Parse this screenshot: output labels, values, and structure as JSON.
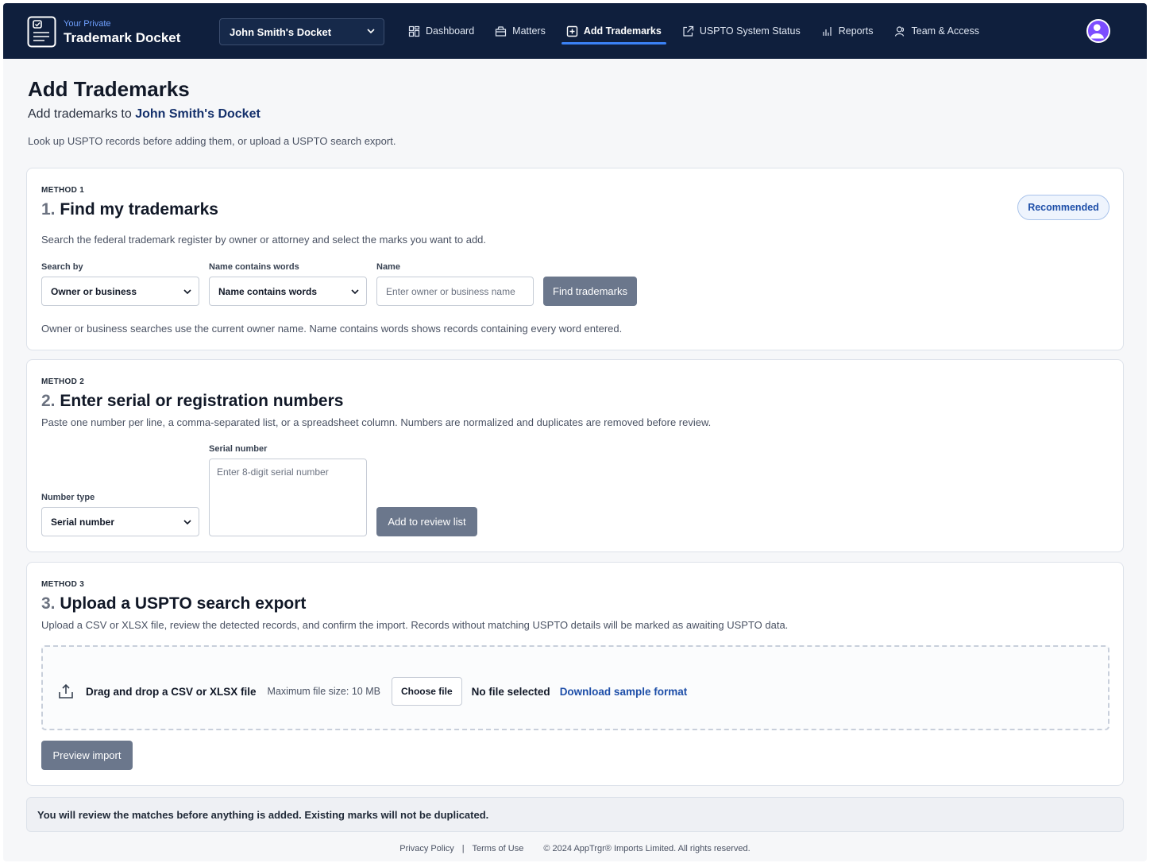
{
  "brand": {
    "sub": "Your Private",
    "title": "Trademark Docket"
  },
  "docket_selector": {
    "value": "John Smith's Docket"
  },
  "nav": {
    "dashboard": "Dashboard",
    "matters": "Matters",
    "add_trademarks": "Add Trademarks",
    "uspto_status": "USPTO System Status",
    "reports": "Reports",
    "team_access": "Team & Access"
  },
  "header": {
    "title": "Add Trademarks",
    "subtitle_prefix": "Add trademarks to",
    "subtitle_docket": "John Smith's Docket",
    "description": "Look up USPTO records before adding them, or upload a USPTO search export."
  },
  "method1": {
    "tag": "METHOD 1",
    "number": "1.",
    "title": "Find my trademarks",
    "badge": "Recommended",
    "description": "Search the federal trademark register by owner or attorney and select the marks you want to add.",
    "search_by_label": "Search by",
    "search_by_value": "Owner or business",
    "match_label": "Name contains words",
    "match_value": "Name contains words",
    "name_label": "Name",
    "name_placeholder": "Enter owner or business name",
    "button": "Find trademarks",
    "hint": "Owner or business searches use the current owner name. Name contains words shows records containing every word entered."
  },
  "method2": {
    "tag": "METHOD 2",
    "number": "2.",
    "title": "Enter serial or registration numbers",
    "description": "Paste one number per line, a comma-separated list, or a spreadsheet column. Numbers are normalized and duplicates are removed before review.",
    "type_label": "Number type",
    "type_value": "Serial number",
    "serial_label": "Serial number",
    "serial_placeholder": "Enter 8-digit serial number",
    "button": "Add to review list"
  },
  "method3": {
    "tag": "METHOD 3",
    "number": "3.",
    "title": "Upload a USPTO search export",
    "description": "Upload a CSV or XLSX file, review the detected records, and confirm the import. Records without matching USPTO details will be marked as awaiting USPTO data.",
    "drop_text": "Drag and drop a CSV or XLSX file",
    "max_size": "Maximum file size: 10 MB",
    "choose_button": "Choose file",
    "file_status": "No file selected",
    "sample_link": "Download sample format",
    "preview_button": "Preview import"
  },
  "notice": "You will review the matches before anything is added. Existing marks will not be duplicated.",
  "footer": {
    "privacy": "Privacy Policy",
    "separator": "|",
    "terms": "Terms of Use",
    "copyright": "© 2024 AppTrgr® Imports Limited. All rights reserved."
  },
  "colors": {
    "topbar": "#0f1f3d",
    "accent": "#3b82f6",
    "link": "#1d4ea8",
    "button": "#6b778c",
    "avatar": "#7c4dff"
  }
}
